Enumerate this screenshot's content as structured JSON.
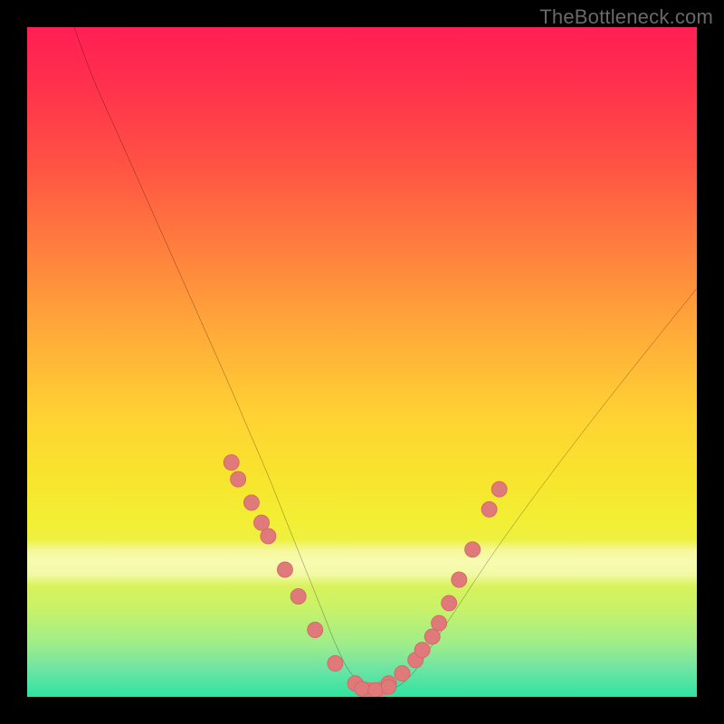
{
  "watermark": "TheBottleneck.com",
  "chart_data": {
    "type": "line",
    "title": "",
    "xlabel": "",
    "ylabel": "",
    "xlim": [
      0,
      100
    ],
    "ylim": [
      0,
      100
    ],
    "series": [
      {
        "name": "bottleneck-curve",
        "x": [
          7,
          10,
          14,
          18,
          22,
          26,
          30,
          33,
          36,
          38,
          40,
          42,
          44,
          46,
          48,
          50,
          52,
          54,
          56,
          58,
          60,
          64,
          70,
          78,
          88,
          100
        ],
        "y": [
          100,
          92,
          83,
          74,
          65,
          56,
          47,
          40,
          33,
          28,
          23,
          18,
          13,
          8,
          4,
          2,
          1,
          1,
          2,
          4,
          7,
          13,
          22,
          33,
          46,
          61
        ]
      }
    ],
    "dots": {
      "name": "highlighted-points",
      "x_left": [
        30.5,
        31.5,
        33.5,
        35.0,
        36.0,
        38.5,
        40.5,
        43.0,
        46.0,
        49.0
      ],
      "y_left": [
        35.0,
        32.5,
        29.0,
        26.0,
        24.0,
        19.0,
        15.0,
        10.0,
        5.0,
        2.0
      ],
      "x_right": [
        54.0,
        56.0,
        58.0,
        59.0,
        60.5,
        61.5,
        63.0,
        64.5,
        66.5,
        69.0,
        70.5
      ],
      "y_right": [
        2.0,
        3.5,
        5.5,
        7.0,
        9.0,
        11.0,
        14.0,
        17.5,
        22.0,
        28.0,
        31.0
      ],
      "x_floor": [
        50.0,
        52.0,
        54.0
      ],
      "y_floor": [
        1.2,
        1.0,
        1.5
      ]
    },
    "colors": {
      "curve": "#000000",
      "dot_fill": "#e07a7a",
      "dot_stroke": "#d46666"
    }
  }
}
